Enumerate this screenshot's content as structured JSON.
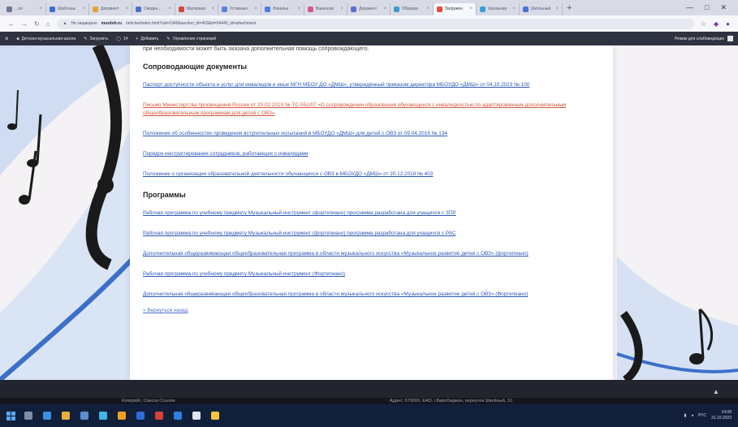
{
  "browser": {
    "tabs": [
      {
        "label": "...ля",
        "color": "#6b7690",
        "active": false
      },
      {
        "label": "Шаблоны",
        "color": "#3d6fd6",
        "active": false
      },
      {
        "label": "Документ",
        "color": "#e0a23a",
        "active": false
      },
      {
        "label": "Сведен...",
        "color": "#4f6fc8",
        "active": false
      },
      {
        "label": "Материал",
        "color": "#d4483b",
        "active": false
      },
      {
        "label": "Уставные",
        "color": "#5a84d8",
        "active": false
      },
      {
        "label": "Локальн",
        "color": "#4d7ee0",
        "active": false
      },
      {
        "label": "Вакансии",
        "color": "#d15a8c",
        "active": false
      },
      {
        "label": "Документ",
        "color": "#5b6fcf",
        "active": false
      },
      {
        "label": "Образов",
        "color": "#3c9bd0",
        "active": false
      },
      {
        "label": "Загружен",
        "color": "#e04b3a",
        "active": true
      },
      {
        "label": "Школьная",
        "color": "#3aa0d8",
        "active": false
      },
      {
        "label": "Школьный",
        "color": "#4a74d4",
        "active": false
      }
    ],
    "new_tab": "+",
    "window_controls": [
      "—",
      "□",
      "✕"
    ],
    "address": {
      "security": "Не защищено",
      "host": "muzdsh.ru",
      "path": "/articles/index.html?sid=1945&section_id=403&id=54445_id=attachment",
      "icons": [
        "star-icon",
        "extension-icon",
        "profile-icon"
      ]
    },
    "bookmarks": [
      {
        "label": "Детская музыкальная школа"
      },
      {
        "label": "Загрузить"
      },
      {
        "label": "14"
      },
      {
        "label": "Добавить"
      },
      {
        "label": "Управление страницей"
      }
    ],
    "bookmarks_right": "Режим для слабовидящих"
  },
  "page": {
    "topline": "при необходимости может быть оказана дополнительная помощь сопровождающего.",
    "sections": [
      {
        "title": "Сопроводающие документы",
        "links": [
          {
            "text": "Паспорт доступности объекта и услуг для инвалидов и иных МГН МБОУ ДО «ДМШ», утверждённый приказом директора МБОУДО «ДМШ» от 04.10.2023 № 100",
            "red": false
          },
          {
            "text": "Письмо Министерства просвещения России от 20.02.2019 № ТС-551/07 «О сопровождении образования обучающихся с инвалидностью по адаптированным дополнительным общеобразовательным программам для детей с ОВЗ»",
            "red": true
          },
          {
            "text": "Положение об особенностях проведения вступительных испытаний в МБОУДО «ДМШ» для детей с ОВЗ от 09.04.2019 № 134",
            "red": false
          },
          {
            "text": "Порядок инструктирования сотрудников, работающих с инвалидами",
            "red": false
          },
          {
            "text": "Положение о организации образовательной деятельности обучающихся с ОВЗ в МБОУДО «ДМШ» от 20.12.2018 № 403",
            "red": false
          }
        ]
      },
      {
        "title": "Программы",
        "links": [
          {
            "text": "Рабочая программа по учебному предмету Музыкальный инструмент (фортепиано) программа разработана для учащихся с ЗПР",
            "red": false
          },
          {
            "text": "Рабочая программа по учебному предмету Музыкальный инструмент (фортепиано) программа разработана для учащихся с РАС",
            "red": false
          },
          {
            "text": "Дополнительная общеразвивающая общеобразовательная программа в области музыкального искусства «Музыкальное развитие детей с ОВЗ» (фортепиано)",
            "red": false
          },
          {
            "text": "Рабочая программа по учебному предмету Музыкальный инструмент (Фортепиано)",
            "red": false
          },
          {
            "text": "Дополнительная общеразвивающая общеобразовательная программа в области музыкального искусства «Музыкальное развитие детей с ОВЗ» (Фортепиано)",
            "red": false
          }
        ]
      }
    ],
    "back_link": "« Вернуться назад"
  },
  "footer": {
    "left": "Копирайт, Список Ссылок",
    "right": "Адрес: 679000, ЕАО, г.Биробиджан, переулок Швейный, 10",
    "scroll_up": "▲"
  },
  "taskbar": {
    "time": "14:08",
    "date": "31.10.2023",
    "lang": "РУС",
    "apps": [
      {
        "color": "#7f8ea8"
      },
      {
        "color": "#3f8fe0"
      },
      {
        "color": "#e8b23a"
      },
      {
        "color": "#5a8fd0"
      },
      {
        "color": "#3fb6e8"
      },
      {
        "color": "#f2a01f"
      },
      {
        "color": "#2f6cd8"
      },
      {
        "color": "#d8403a"
      },
      {
        "color": "#2b82e0"
      },
      {
        "color": "#e0e4ec"
      },
      {
        "color": "#f2c53d"
      }
    ]
  }
}
